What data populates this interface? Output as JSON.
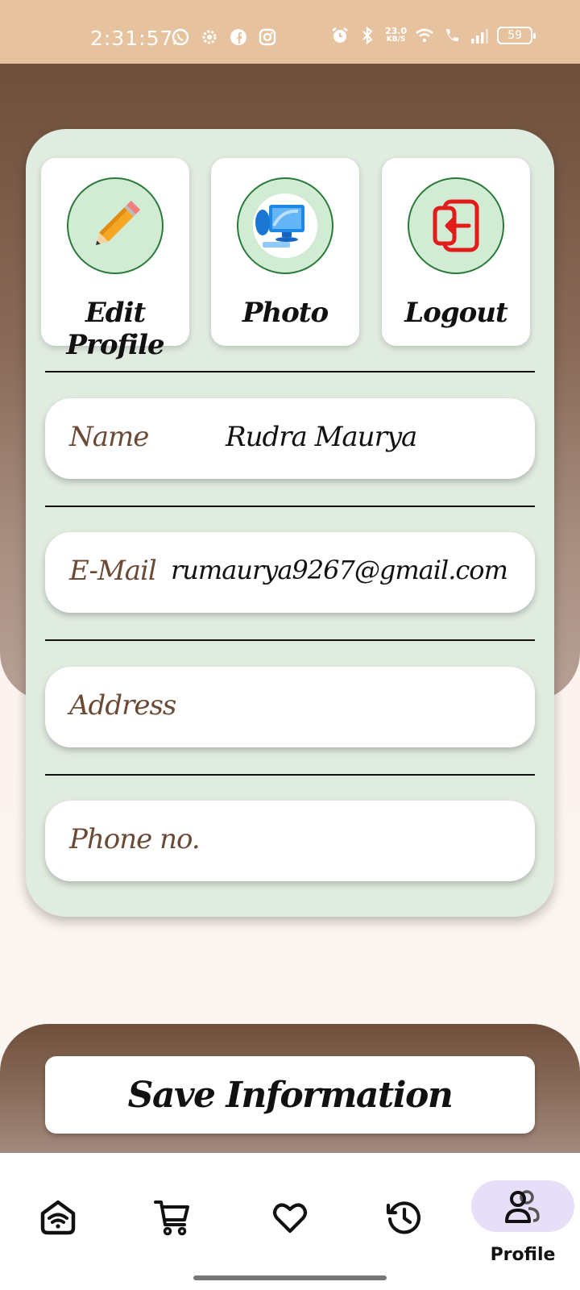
{
  "status_bar": {
    "time": "2:31:57",
    "net_speed_value": "23.0",
    "net_speed_unit": "KB/S",
    "battery": "59",
    "left_icons": [
      "whatsapp-icon",
      "settings-icon",
      "facebook-icon",
      "instagram-icon"
    ],
    "right_icons": [
      "alarm-icon",
      "bluetooth-icon",
      "wifi-icon",
      "wifi-call-icon",
      "signal-icon",
      "battery-icon"
    ]
  },
  "actions": [
    {
      "label": "Edit Profile",
      "icon": "pencil-icon"
    },
    {
      "label": "Photo",
      "icon": "computer-photo-icon"
    },
    {
      "label": "Logout",
      "icon": "logout-icon"
    }
  ],
  "fields": {
    "name": {
      "label": "Name",
      "value": "Rudra Maurya"
    },
    "email": {
      "label": "E-Mail",
      "value": "rumaurya9267@gmail.com"
    },
    "address": {
      "label": "Address",
      "value": ""
    },
    "phone": {
      "label": "Phone no.",
      "value": ""
    }
  },
  "save_button": {
    "label": "Save Information"
  },
  "nav": {
    "items": [
      "home-wifi-icon",
      "cart-icon",
      "heart-icon",
      "history-icon",
      "profile-icon"
    ],
    "active_label": "Profile"
  },
  "colors": {
    "status_bar": "#e6c39e",
    "brown": "#6e4f3a",
    "card": "#e1ece1",
    "label_brown": "#6b4a35",
    "nav_active_pill": "#e7def7"
  }
}
